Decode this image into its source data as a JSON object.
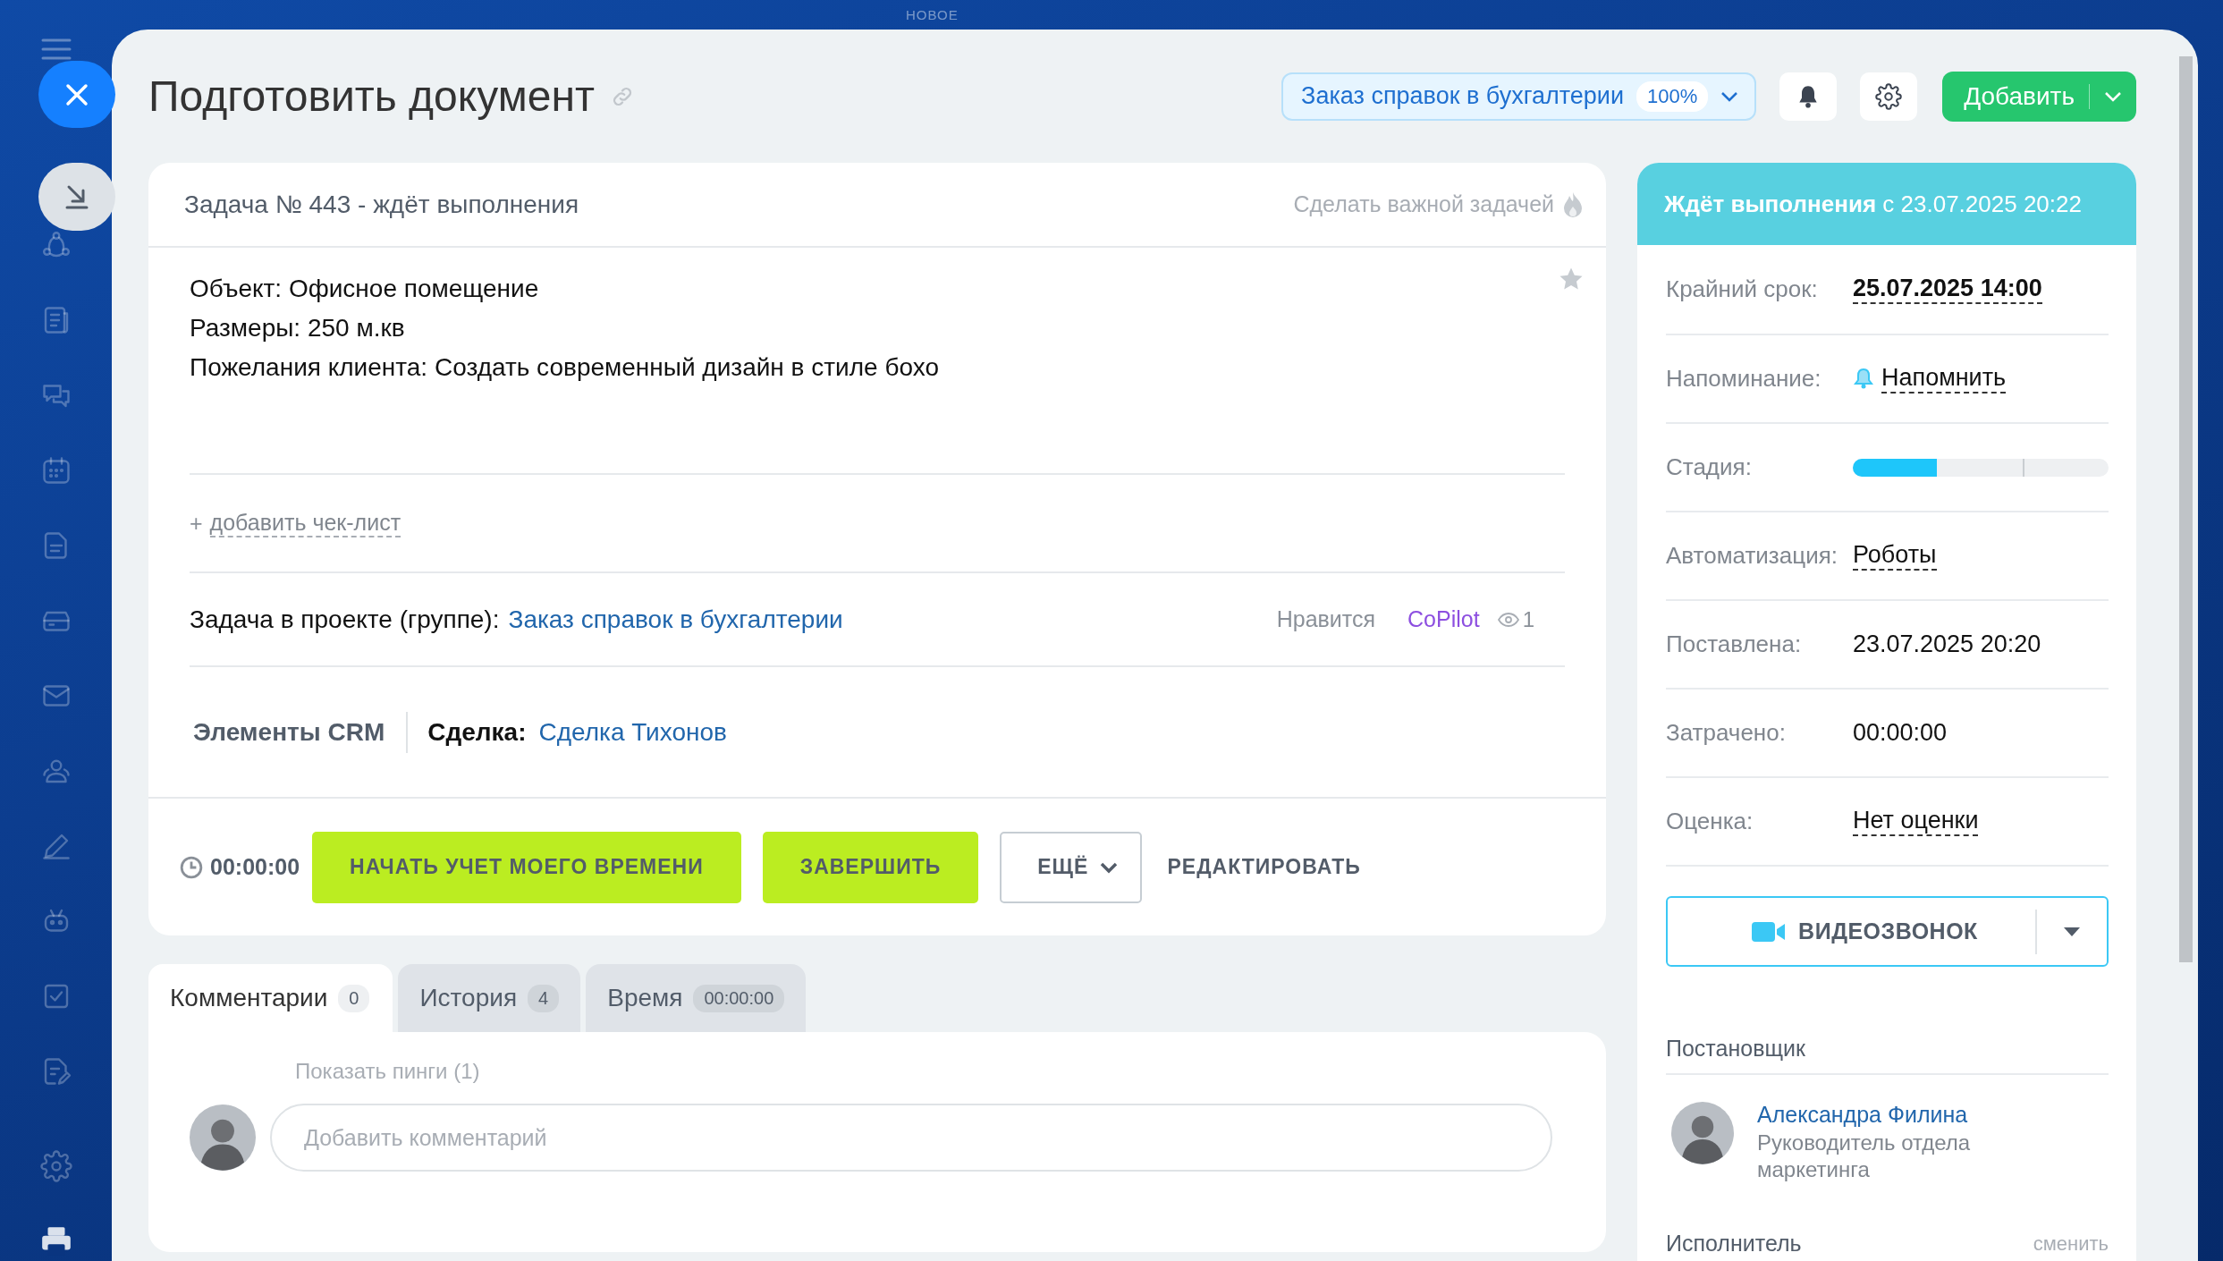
{
  "background": {
    "label": "НОВОЕ"
  },
  "header": {
    "title": "Подготовить документ",
    "project": {
      "label": "Заказ справок в бухгалтерии",
      "percent": "100%"
    },
    "add_button": "Добавить"
  },
  "task": {
    "heading": "Задача № 443 - ждёт выполнения",
    "important_link": "Сделать важной задачей",
    "starred": false,
    "description": [
      "Объект: Офисное помещение",
      "Размеры: 250 м.кв",
      "Пожелания клиента: Создать современный дизайн в стиле бохо"
    ],
    "add_checklist": {
      "icon": "+",
      "label": "добавить чек-лист"
    },
    "project_row": {
      "label": "Задача в проекте (группе):",
      "link": "Заказ справок в бухгалтерии",
      "like": "Нравится",
      "copilot": "CoPilot",
      "views": "1"
    },
    "crm": {
      "label": "Элементы CRM",
      "field": "Сделка:",
      "value": "Сделка Тихонов"
    },
    "footer": {
      "timer": "00:00:00",
      "buttons": [
        {
          "label": "НАЧАТЬ УЧЕТ МОЕГО ВРЕМЕНИ",
          "kind": "primary"
        },
        {
          "label": "ЗАВЕРШИТЬ",
          "kind": "primary"
        },
        {
          "label": "ЕЩЁ",
          "kind": "dropdown"
        },
        {
          "label": "РЕДАКТИРОВАТЬ",
          "kind": "link"
        }
      ]
    }
  },
  "tabs": [
    {
      "label": "Комментарии",
      "count": "0",
      "selected": true
    },
    {
      "label": "История",
      "count": "4",
      "selected": false
    },
    {
      "label": "Время",
      "count": "00:00:00",
      "selected": false
    }
  ],
  "comments": {
    "pings": "Показать пинги (1)",
    "placeholder": "Добавить комментарий"
  },
  "status": {
    "state": "Ждёт выполнения",
    "since": "с 23.07.2025 20:22"
  },
  "fields": [
    {
      "label": "Крайний срок:",
      "value": "25.07.2025 14:00",
      "kind": "deadline"
    },
    {
      "label": "Напоминание:",
      "value": "Напомнить",
      "kind": "reminder"
    },
    {
      "label": "Стадия:",
      "kind": "stage",
      "level": 0.33
    },
    {
      "label": "Автоматизация:",
      "value": "Роботы",
      "kind": "link"
    },
    {
      "label": "Поставлена:",
      "value": "23.07.2025 20:20",
      "kind": "text"
    },
    {
      "label": "Затрачено:",
      "value": "00:00:00",
      "kind": "text"
    },
    {
      "label": "Оценка:",
      "value": "Нет оценки",
      "kind": "link"
    }
  ],
  "video_call": "ВИДЕОЗВОНОК",
  "creator": {
    "heading": "Постановщик",
    "name": "Александра Филина",
    "role": "Руководитель отдела маркетинга"
  },
  "assignee": {
    "heading": "Исполнитель",
    "action": "сменить"
  }
}
